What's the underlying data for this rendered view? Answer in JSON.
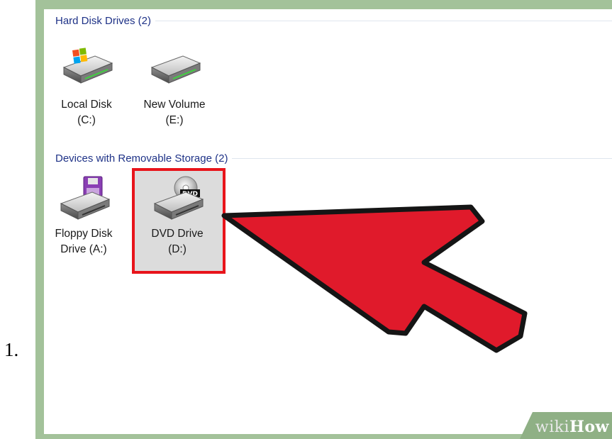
{
  "list_number": "1.",
  "explorer": {
    "groups": [
      {
        "header": "Hard Disk Drives (2)",
        "drives": [
          {
            "line1": "Local Disk",
            "line2": "(C:)",
            "icon": "system-hard-drive-icon"
          },
          {
            "line1": "New Volume",
            "line2": "(E:)",
            "icon": "hard-drive-icon"
          }
        ]
      },
      {
        "header": "Devices with Removable Storage (2)",
        "drives": [
          {
            "line1": "Floppy Disk",
            "line2": "Drive (A:)",
            "icon": "floppy-drive-icon"
          },
          {
            "line1": "DVD Drive",
            "line2": "(D:)",
            "icon": "dvd-drive-icon",
            "selected": true
          }
        ]
      }
    ]
  },
  "dvd_badge": "DVD",
  "watermark": {
    "part1": "wiki",
    "part2": "How"
  },
  "colors": {
    "frame": "#a3c29a",
    "header_text": "#1e3287",
    "highlight_border": "#e8141b",
    "arrow_fill": "#e01a2b"
  }
}
